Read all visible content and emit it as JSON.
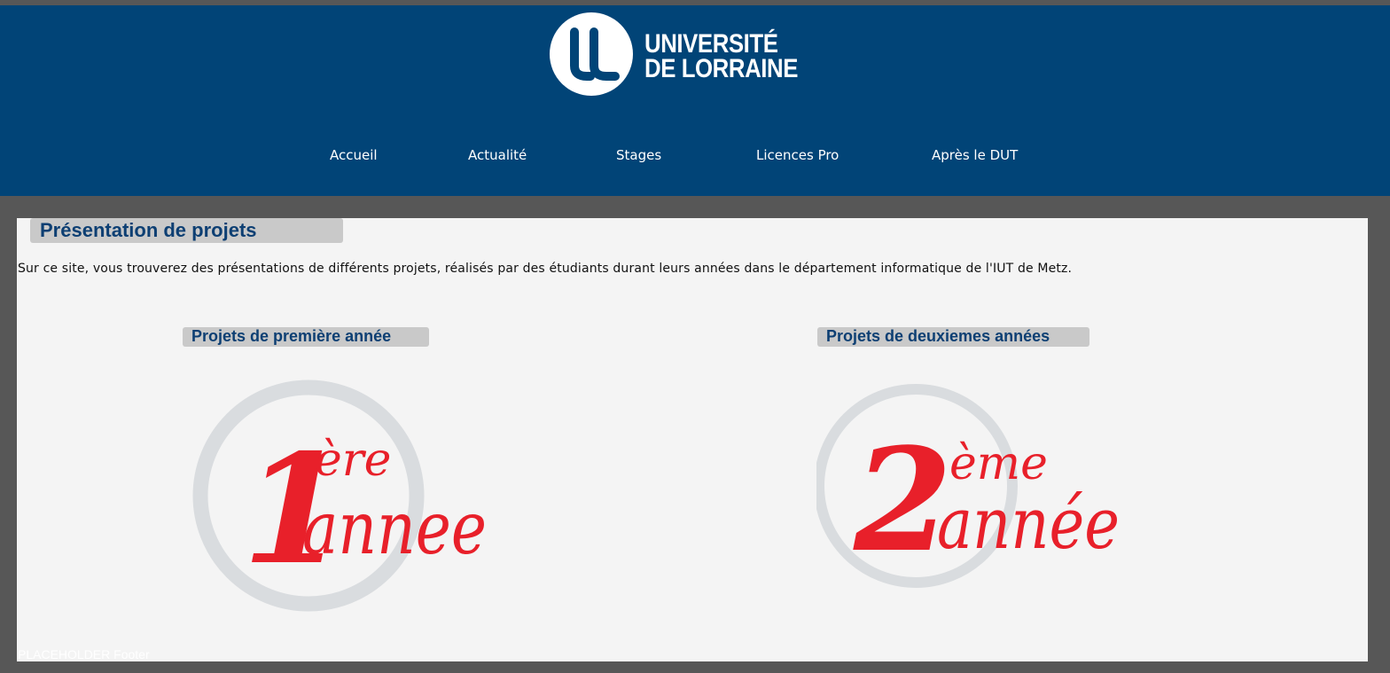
{
  "header": {
    "logo": {
      "line1": "UNIVERSITÉ",
      "line2": "DE LORRAINE",
      "icon": "ul-logo-icon"
    },
    "nav": [
      {
        "label": "Accueil"
      },
      {
        "label": "Actualité"
      },
      {
        "label": "Stages"
      },
      {
        "label": "Licences Pro"
      },
      {
        "label": "Après le DUT"
      }
    ]
  },
  "main": {
    "title": "Présentation de projets",
    "intro": "Sur ce site, vous trouverez des présentations de différents projets, réalisés par des étudiants durant leurs années dans le département informatique de l'IUT de Metz.",
    "sections": [
      {
        "label": "Projets de première année",
        "badge": {
          "number": "1",
          "suffix": "ère",
          "word": "annee"
        }
      },
      {
        "label": "Projets de deuxiemes années",
        "badge": {
          "number": "2",
          "suffix": "ème",
          "word": "année"
        }
      }
    ]
  },
  "footer": {
    "text": "PLACEHOLDER Footer"
  },
  "colors": {
    "header_bg": "#014477",
    "page_bg": "#575757",
    "content_bg": "#f4f4f4",
    "label_bg": "#c9c9c9",
    "title_text": "#0d3f73",
    "badge_red": "#e8202a",
    "badge_ring": "#d9dcdf"
  }
}
